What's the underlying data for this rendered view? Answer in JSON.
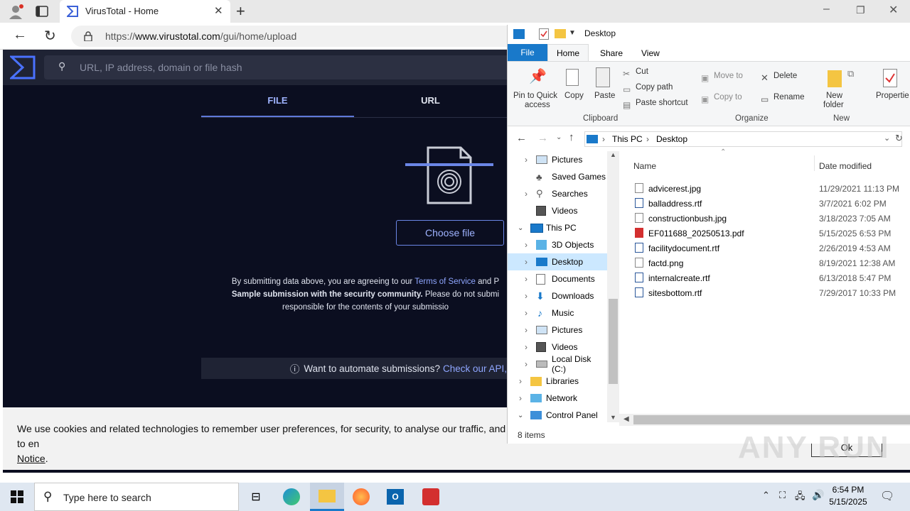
{
  "browser": {
    "tab_title": "VirusTotal - Home",
    "url_prefix": "https://",
    "url_domain": "www.virustotal.com",
    "url_path": "/gui/home/upload"
  },
  "vt": {
    "search_placeholder": "URL, IP address, domain or file hash",
    "tab_file": "FILE",
    "tab_url": "URL",
    "choose_file": "Choose file",
    "terms_1": "By submitting data above, you are agreeing to our ",
    "terms_link": "Terms of Service",
    "terms_2": " and P",
    "terms_3": "Sample submission with the security community.",
    "terms_4": " Please do not submi",
    "terms_5": "responsible for the contents of your submissio",
    "automate_text": "Want to automate submissions? ",
    "automate_link": "Check our API,",
    "cookie_text": "We use cookies and related technologies to remember user preferences, for security, to analyse our traffic, and to en",
    "cookie_link": "Notice",
    "cookie_end": ".",
    "ok_button": "Ok"
  },
  "explorer": {
    "title": "Desktop",
    "menu_tabs": [
      "File",
      "Home",
      "Share",
      "View"
    ],
    "ribbon": {
      "pin": "Pin to Quick",
      "pin2": "access",
      "copy": "Copy",
      "paste": "Paste",
      "cut": "Cut",
      "copy_path": "Copy path",
      "paste_shortcut": "Paste shortcut",
      "move_to": "Move to",
      "copy_to": "Copy to",
      "delete": "Delete",
      "rename": "Rename",
      "new_folder": "New",
      "new_folder2": "folder",
      "properties": "Propertie",
      "group_clipboard": "Clipboard",
      "group_organize": "Organize",
      "group_new": "New"
    },
    "path": [
      "This PC",
      "Desktop"
    ],
    "tree": [
      {
        "label": "Pictures",
        "icon": "pictures-icon"
      },
      {
        "label": "Saved Games",
        "icon": "games-icon"
      },
      {
        "label": "Searches",
        "icon": "search-icon"
      },
      {
        "label": "Videos",
        "icon": "videos-icon"
      },
      {
        "label": "This PC",
        "icon": "pc-icon"
      },
      {
        "label": "3D Objects",
        "icon": "3d-icon"
      },
      {
        "label": "Desktop",
        "icon": "desktop-icon"
      },
      {
        "label": "Documents",
        "icon": "documents-icon"
      },
      {
        "label": "Downloads",
        "icon": "downloads-icon"
      },
      {
        "label": "Music",
        "icon": "music-icon"
      },
      {
        "label": "Pictures",
        "icon": "pictures-icon"
      },
      {
        "label": "Videos",
        "icon": "videos-icon"
      },
      {
        "label": "Local Disk (C:)",
        "icon": "disk-icon"
      },
      {
        "label": "Libraries",
        "icon": "folder-icon"
      },
      {
        "label": "Network",
        "icon": "network-icon"
      },
      {
        "label": "Control Panel",
        "icon": "control-panel-icon"
      }
    ],
    "columns": {
      "name": "Name",
      "date": "Date modified"
    },
    "files": [
      {
        "name": "advicerest.jpg",
        "date": "11/29/2021 11:13 PM",
        "type": "jpg"
      },
      {
        "name": "balladdress.rtf",
        "date": "3/7/2021 6:02 PM",
        "type": "rtf"
      },
      {
        "name": "constructionbush.jpg",
        "date": "3/18/2023 7:05 AM",
        "type": "jpg"
      },
      {
        "name": "EF011688_20250513.pdf",
        "date": "5/15/2025 6:53 PM",
        "type": "pdf"
      },
      {
        "name": "facilitydocument.rtf",
        "date": "2/26/2019 4:53 AM",
        "type": "rtf"
      },
      {
        "name": "factd.png",
        "date": "8/19/2021 12:38 AM",
        "type": "png"
      },
      {
        "name": "internalcreate.rtf",
        "date": "6/13/2018 5:47 PM",
        "type": "rtf"
      },
      {
        "name": "sitesbottom.rtf",
        "date": "7/29/2017 10:33 PM",
        "type": "rtf"
      }
    ],
    "status": "8 items"
  },
  "taskbar": {
    "search_placeholder": "Type here to search",
    "time": "6:54 PM",
    "date": "5/15/2025"
  },
  "watermark": "ANY RUN",
  "colors": {
    "vt_bg": "#0b0e20",
    "vt_accent": "#5f79d9",
    "explorer_file_tab": "#1979ca",
    "selected_tree": "#cce8ff"
  }
}
